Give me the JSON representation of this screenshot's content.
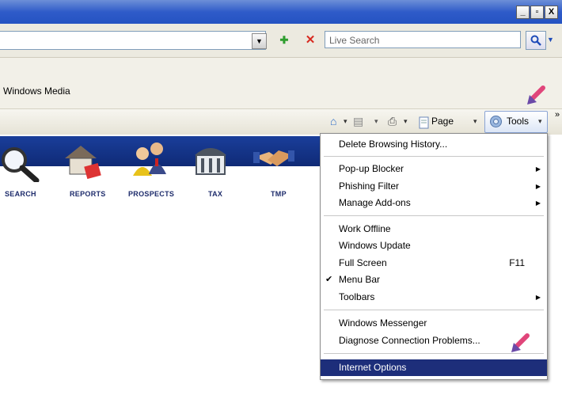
{
  "window": {
    "minimize": "_",
    "maximize": "▫",
    "close": "X"
  },
  "address_bar": {
    "dropdown": "▼",
    "go": "✚",
    "stop": "✕",
    "search_placeholder": "Live Search",
    "search_icon": "search-icon",
    "search_drop": "▼"
  },
  "links_bar": {
    "label": "Windows Media"
  },
  "command_bar": {
    "home_icon": "⌂",
    "feeds_icon": "▤",
    "print_icon": "⎙",
    "page_label": "Page",
    "tools_label": "Tools",
    "more": "»"
  },
  "banner": {
    "items": [
      {
        "label": "SEARCH",
        "icon": "magnifier-icon"
      },
      {
        "label": "REPORTS",
        "icon": "house-icon"
      },
      {
        "label": "PROSPECTS",
        "icon": "people-icon"
      },
      {
        "label": "TAX",
        "icon": "building-icon"
      },
      {
        "label": "TMP",
        "icon": "handshake-icon"
      }
    ]
  },
  "tools_menu": {
    "items": [
      {
        "label": "Delete Browsing History...",
        "shortcut": "",
        "submenu": false,
        "checked": false
      },
      {
        "label": "Pop-up Blocker",
        "shortcut": "",
        "submenu": true,
        "checked": false
      },
      {
        "label": "Phishing Filter",
        "shortcut": "",
        "submenu": true,
        "checked": false
      },
      {
        "label": "Manage Add-ons",
        "shortcut": "",
        "submenu": true,
        "checked": false
      },
      {
        "label": "Work Offline",
        "shortcut": "",
        "submenu": false,
        "checked": false
      },
      {
        "label": "Windows Update",
        "shortcut": "",
        "submenu": false,
        "checked": false
      },
      {
        "label": "Full Screen",
        "shortcut": "F11",
        "submenu": false,
        "checked": false
      },
      {
        "label": "Menu Bar",
        "shortcut": "",
        "submenu": false,
        "checked": true
      },
      {
        "label": "Toolbars",
        "shortcut": "",
        "submenu": true,
        "checked": false
      },
      {
        "label": "Windows Messenger",
        "shortcut": "",
        "submenu": false,
        "checked": false
      },
      {
        "label": "Diagnose Connection Problems...",
        "shortcut": "",
        "submenu": false,
        "checked": false
      },
      {
        "label": "Internet Options",
        "shortcut": "",
        "submenu": false,
        "checked": false,
        "highlighted": true
      }
    ],
    "checkmark": "✔",
    "submenu_arrow": "▶"
  },
  "colors": {
    "highlight": "#1d2e7a",
    "pointer_arrow": "#e0457a",
    "title_bar": "#2f5bc9"
  }
}
